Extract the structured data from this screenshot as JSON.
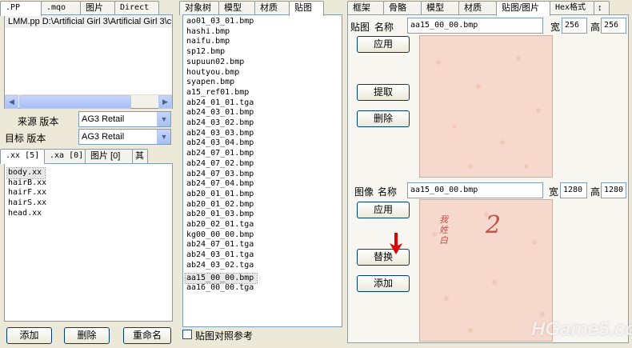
{
  "left": {
    "top_tabs": [
      ".PP",
      ".mqo",
      "图片",
      "Direct"
    ],
    "pp_path": "LMM.pp  D:\\Artificial Girl 3\\Artificial Girl 3\\c",
    "source_version_label": "来源 版本",
    "source_version_value": "AG3 Retail",
    "target_version_label": "目标 版本",
    "target_version_value": "AG3 Retail",
    "file_tabs": [
      ".xx [5]",
      ".xa [0]",
      "图片 [0]",
      "其"
    ],
    "xx_files": [
      "body.xx",
      "hairB.xx",
      "hairF.xx",
      "hairS.xx",
      "head.xx"
    ],
    "buttons": {
      "add": "添加",
      "delete": "删除",
      "rename": "重命名"
    }
  },
  "middle": {
    "tabs": [
      "对象树",
      "模型",
      "材质",
      "贴图"
    ],
    "textures": [
      "ao01_03_01.bmp",
      "hashi.bmp",
      "naifu.bmp",
      "sp12.bmp",
      "supuun02.bmp",
      "houtyou.bmp",
      "syapen.bmp",
      "a15_ref01.bmp",
      "ab24_01_01.tga",
      "ab24_03_01.bmp",
      "ab24_03_02.bmp",
      "ab24_03_03.bmp",
      "ab24_03_04.bmp",
      "ab24_07_01.bmp",
      "ab24_07_02.bmp",
      "ab24_07_03.bmp",
      "ab24_07_04.bmp",
      "ab20_01_01.bmp",
      "ab20_01_02.bmp",
      "ab20_01_03.bmp",
      "ab20_02_01.tga",
      "kg00_00_00.bmp",
      "ab24_07_01.tga",
      "ab24_03_01.tga",
      "ab24_03_02.tga",
      "aa15_00_00.bmp",
      "aa16_00_00.tga"
    ],
    "selected_texture": "aa15_00_00.bmp",
    "checkbox_label": "贴图对照参考"
  },
  "right": {
    "tabs": [
      "框架",
      "骨骼",
      "模型",
      "材质",
      "贴图/图片",
      "Hex格式",
      "↕"
    ],
    "texture_section": {
      "label": "贴图",
      "name_label": "名称",
      "name_value": "aa15_00_00.bmp",
      "width_label": "宽",
      "width_value": "256",
      "height_label": "高",
      "height_value": "256",
      "apply": "应用",
      "extract": "提取",
      "delete": "删除"
    },
    "image_section": {
      "label": "图像",
      "name_label": "名称",
      "name_value": "aa15_00_00.bmp",
      "width_label": "宽",
      "width_value": "1280",
      "height_label": "高",
      "height_value": "1280",
      "apply": "应用",
      "replace": "替换",
      "add": "添加",
      "handwritten_text": "我 姓 白",
      "handwritten_number": "2"
    },
    "watermark": "HGame5.com"
  },
  "colors": {
    "window_bg": "#ece9d8",
    "image_bg": "#f6d9cc",
    "red_arrow": "#e00000",
    "ink": "#c0524a"
  }
}
